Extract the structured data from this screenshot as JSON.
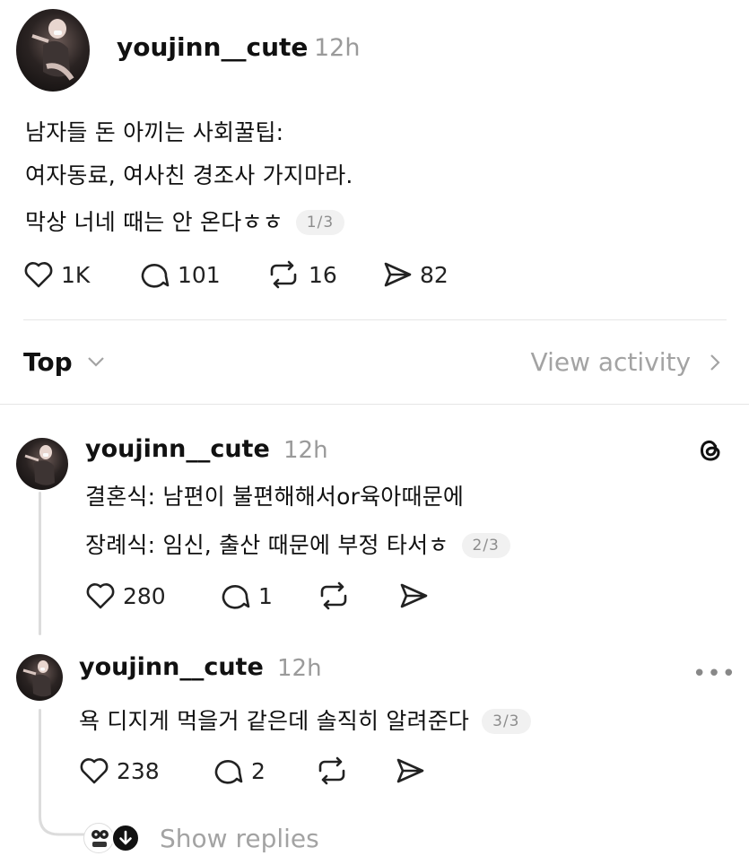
{
  "post": {
    "username": "youjinn__cute",
    "time": "12h",
    "lines": [
      "남자들 돈 아끼는 사회꿀팁:",
      "여자동료, 여사친 경조사 가지마라.",
      "막상 너네 때는 안 온다ㅎㅎ"
    ],
    "pager": "1/3",
    "likes": "1K",
    "comments": "101",
    "reposts": "16",
    "shares": "82"
  },
  "sort": {
    "label": "Top",
    "view_activity": "View activity"
  },
  "reply1": {
    "username": "youjinn__cute",
    "time": "12h",
    "lines": [
      "결혼식: 남편이 불편해해서or육아때문에",
      "장례식: 임신, 출산 때문에 부정 타서ㅎ"
    ],
    "pager": "2/3",
    "likes": "280",
    "comments": "1"
  },
  "reply2": {
    "username": "youjinn__cute",
    "time": "12h",
    "lines": [
      "욕 디지게 먹을거 같은데 솔직히 알려준다"
    ],
    "pager": "3/3",
    "likes": "238",
    "comments": "2"
  },
  "show_replies": "Show replies",
  "icons": [
    "heart-icon",
    "comment-icon",
    "repost-icon",
    "share-icon",
    "chevron-down-icon",
    "chevron-right-icon",
    "threads-logo-icon",
    "more-icon",
    "arrow-down-icon"
  ]
}
